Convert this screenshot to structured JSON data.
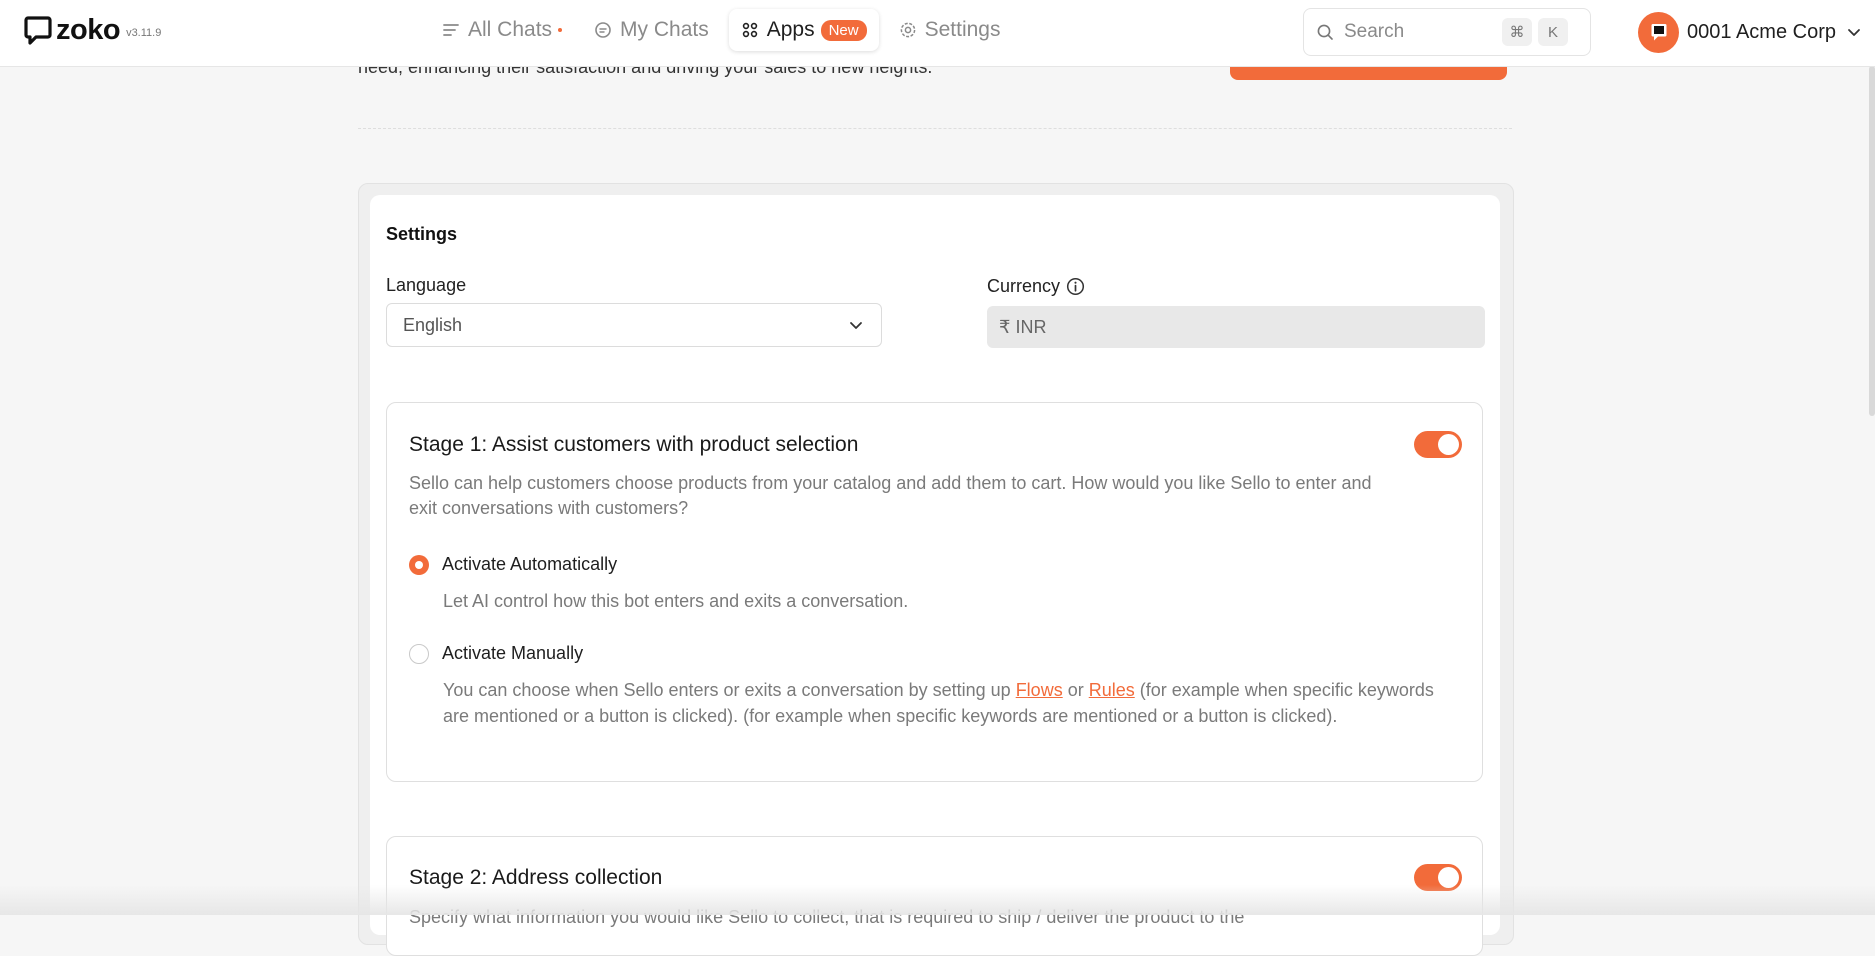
{
  "app": {
    "name": "zoko",
    "version": "v3.11.9"
  },
  "nav": {
    "all_chats": "All Chats",
    "my_chats": "My Chats",
    "apps": "Apps",
    "apps_badge": "New",
    "settings": "Settings"
  },
  "search": {
    "placeholder": "Search",
    "shortcut_cmd": "⌘",
    "shortcut_key": "K"
  },
  "account": {
    "name": "0001 Acme Corp"
  },
  "intro_text": "need, enhancing their satisfaction and driving your sales to new heights.",
  "settings_section": {
    "title": "Settings",
    "language_label": "Language",
    "language_value": "English",
    "currency_label": "Currency",
    "currency_value": "₹ INR"
  },
  "stage1": {
    "title": "Stage 1: Assist customers with product selection",
    "enabled": true,
    "description": "Sello can help customers choose products from your catalog and add them to cart. How would you like Sello to enter and exit conversations with customers?",
    "option_auto": {
      "label": "Activate Automatically",
      "help": "Let AI control how this bot enters and exits a conversation.",
      "selected": true
    },
    "option_manual": {
      "label": "Activate Manually",
      "help_prefix": "You can choose when Sello enters or exits a conversation by setting up ",
      "link_flows": "Flows",
      "help_or": " or ",
      "link_rules": "Rules",
      "help_suffix": " (for example when specific keywords are mentioned or a button is clicked). (for example when specific keywords are mentioned or a button is clicked).",
      "selected": false
    }
  },
  "stage2": {
    "title": "Stage 2: Address collection",
    "enabled": true,
    "description": "Specify what information you would like Sello to collect, that is required to ship / deliver the product to the"
  },
  "colors": {
    "accent": "#f26b3a"
  }
}
